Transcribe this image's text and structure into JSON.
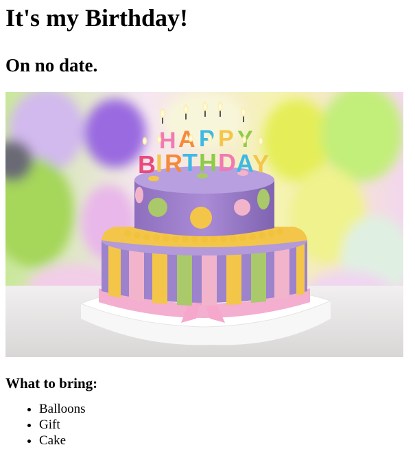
{
  "page": {
    "title": "It's my Birthday!",
    "subtitle": "On no date.",
    "image": {
      "depicts": "two-tier purple birthday cake with lit candles spelling a birthday greeting, colorful balloons in background",
      "candle_text_line1": "HAPPY",
      "candle_text_line2": "BIRTHDAY"
    },
    "bring_heading": "What to bring:",
    "bring_items": [
      "Balloons",
      "Gift",
      "Cake"
    ]
  },
  "colors": {
    "text": "#000000",
    "background": "#ffffff",
    "cake_purple": "#9b7fc7",
    "cake_yellow": "#f3c64a",
    "cake_green": "#a9c96a",
    "cake_pink": "#f2b3c8"
  }
}
